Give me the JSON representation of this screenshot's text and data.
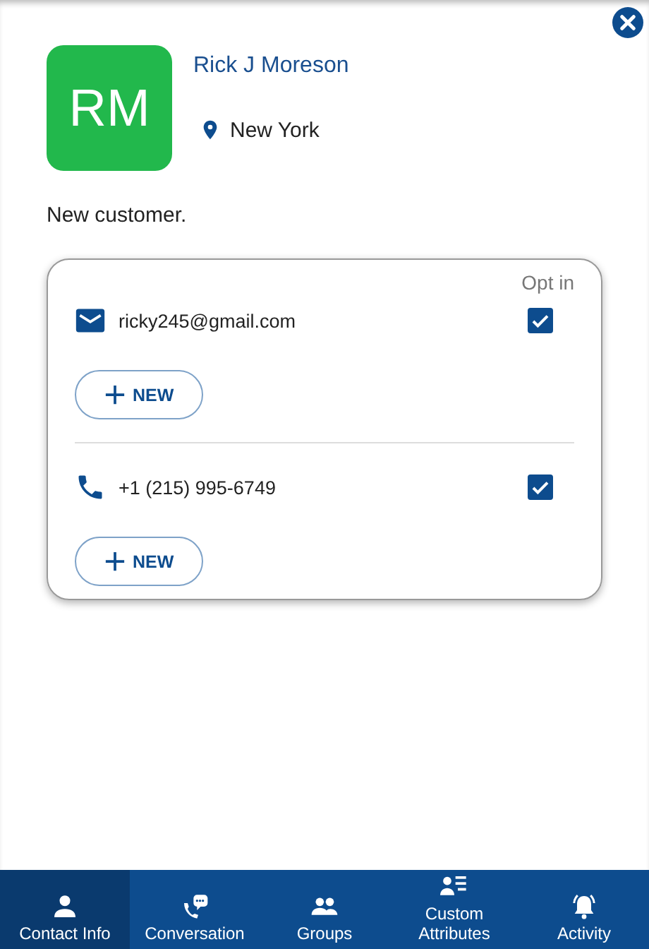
{
  "contact": {
    "initials": "RM",
    "name": "Rick J Moreson",
    "location": "New York",
    "note": "New customer."
  },
  "channels": {
    "header": "Opt in",
    "items": [
      {
        "kind": "email",
        "value": "ricky245@gmail.com",
        "opt_in": true,
        "button": "NEW"
      },
      {
        "kind": "phone",
        "value": "+1 (215) 995-6749",
        "opt_in": true,
        "button": "NEW"
      }
    ]
  },
  "nav": [
    {
      "kind": "person",
      "label": "Contact Info",
      "selected": true
    },
    {
      "kind": "chat",
      "label": "Conversation",
      "selected": false
    },
    {
      "kind": "group",
      "label": "Groups",
      "selected": false
    },
    {
      "kind": "list",
      "label": "Custom Attributes",
      "selected": false
    },
    {
      "kind": "bell",
      "label": "Activity",
      "selected": false
    }
  ]
}
